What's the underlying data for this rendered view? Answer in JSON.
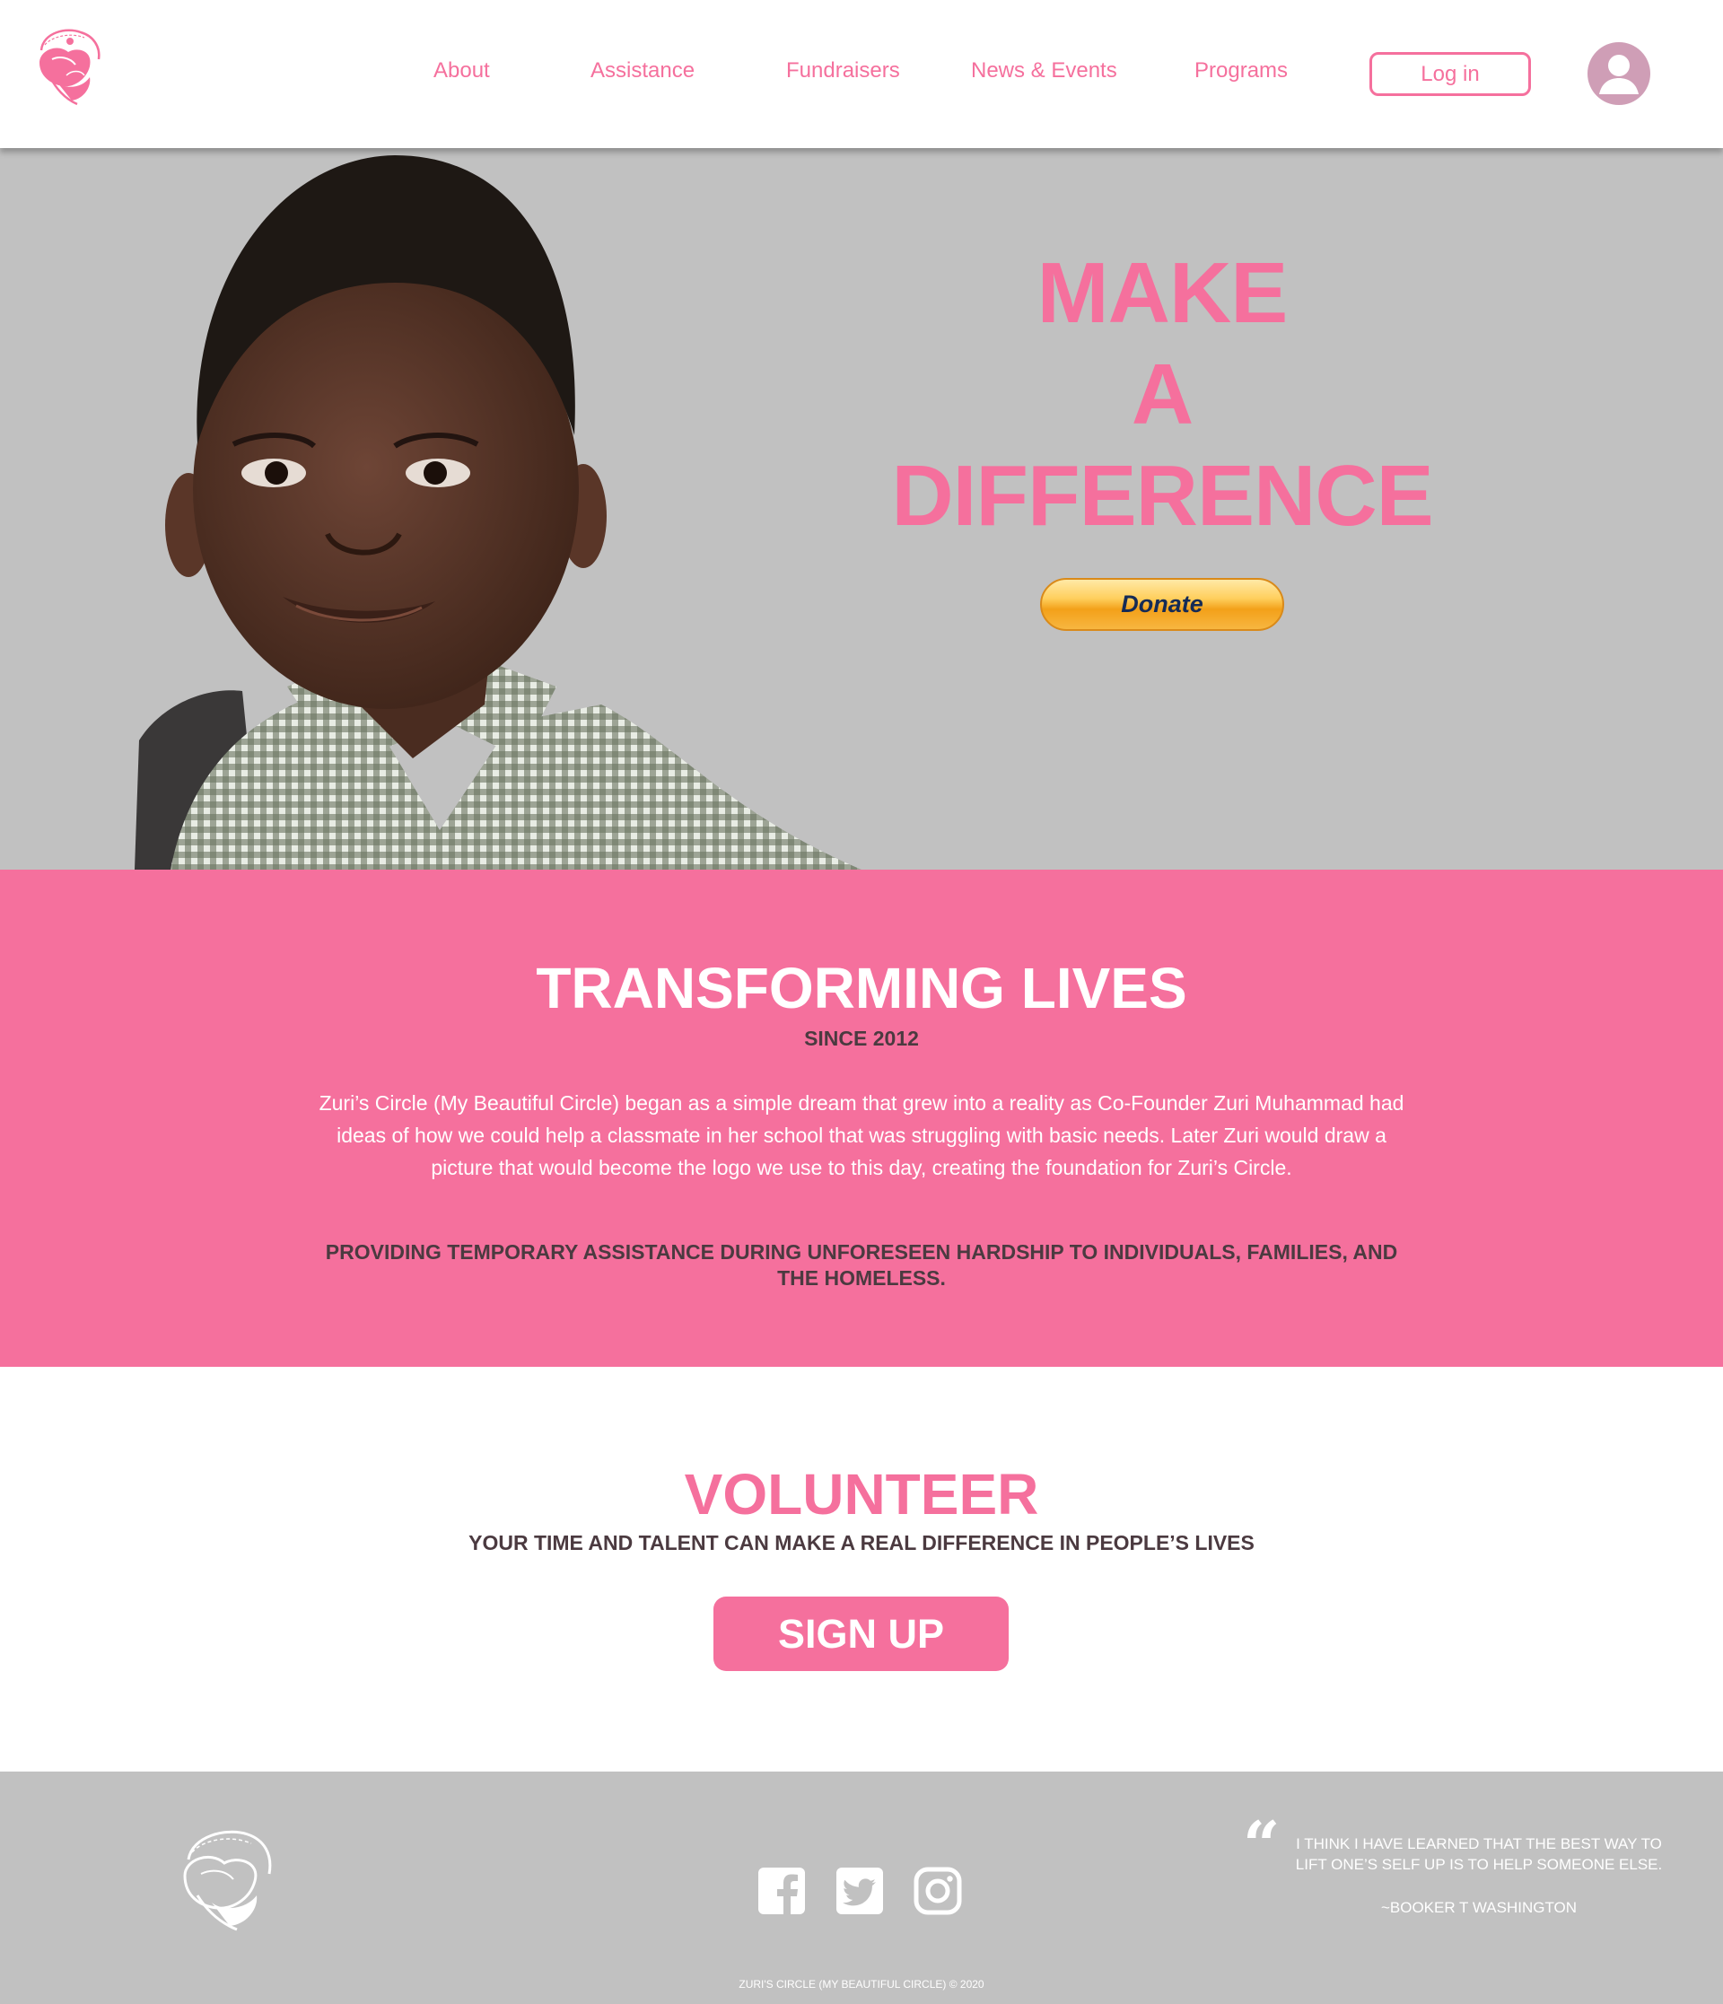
{
  "header": {
    "nav": [
      {
        "label": "About"
      },
      {
        "label": "Assistance"
      },
      {
        "label": "Fundraisers"
      },
      {
        "label": "News & Events"
      },
      {
        "label": "Programs"
      }
    ],
    "login_label": "Log in"
  },
  "hero": {
    "title_lines": [
      "MAKE",
      "A",
      "DIFFERENCE"
    ],
    "donate_label": "Donate"
  },
  "transform": {
    "title": "TRANSFORMING LIVES",
    "since": "SINCE 2012",
    "text": "Zuri’s Circle (My Beautiful Circle) began as a simple dream that grew into a reality as Co-Founder Zuri Muhammad had ideas of how we could help a classmate in her school that was struggling with basic needs. Later Zuri would draw a picture that would become the logo we use to this day, creating the foundation for Zuri’s Circle.",
    "mission": "PROVIDING TEMPORARY ASSISTANCE DURING UNFORESEEN HARDSHIP TO INDIVIDUALS, FAMILIES, AND THE HOMELESS."
  },
  "volunteer": {
    "title": "VOLUNTEER",
    "subtitle": "YOUR TIME AND TALENT CAN MAKE A REAL DIFFERENCE IN PEOPLE’S LIVES",
    "signup_label": "SIGN UP"
  },
  "footer": {
    "social": [
      {
        "icon": "facebook-icon"
      },
      {
        "icon": "twitter-icon"
      },
      {
        "icon": "instagram-icon"
      }
    ],
    "quote_mark": "“",
    "quote": "I THINK I HAVE LEARNED THAT THE BEST WAY TO LIFT ONE’S SELF UP IS TO HELP SOMEONE ELSE.",
    "quote_author": "~BOOKER T WASHINGTON",
    "copyright": "ZURI'S CIRCLE (MY BEAUTIFUL CIRCLE) © 2020"
  },
  "colors": {
    "accent_pink": "#f5709d",
    "gray_section": "#c1c1c1",
    "dark_text": "#4b3a40",
    "avatar": "#cf9eb6"
  }
}
